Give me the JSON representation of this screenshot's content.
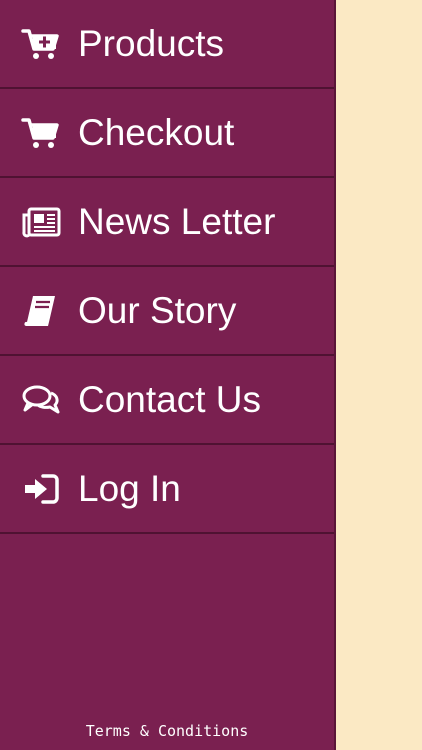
{
  "menu": {
    "items": [
      {
        "label": "Products",
        "icon": "cart-plus-icon"
      },
      {
        "label": "Checkout",
        "icon": "cart-icon"
      },
      {
        "label": "News Letter",
        "icon": "newspaper-icon"
      },
      {
        "label": "Our Story",
        "icon": "book-icon"
      },
      {
        "label": "Contact Us",
        "icon": "chat-bubbles-icon"
      },
      {
        "label": "Log In",
        "icon": "sign-in-icon"
      }
    ]
  },
  "footer": {
    "terms_label": "Terms & Conditions"
  },
  "colors": {
    "drawer_bg": "#7a2050",
    "divider": "#4f1232",
    "text": "#ffffff",
    "background_page": "#fbe9c4"
  }
}
